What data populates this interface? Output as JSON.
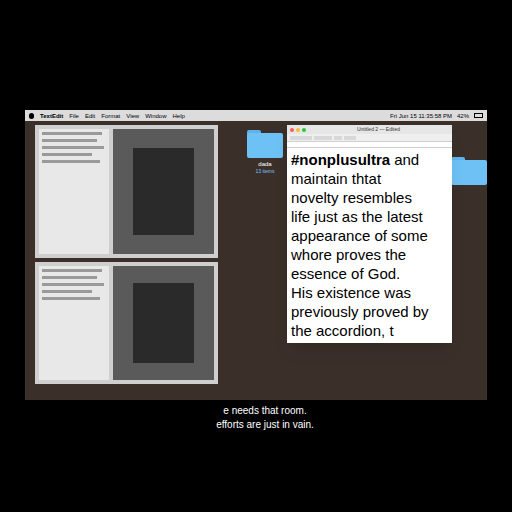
{
  "menubar": {
    "app": "TextEdit",
    "menus": [
      "File",
      "Edit",
      "Format",
      "View",
      "Window",
      "Help"
    ],
    "clock": "Fri Jun 15 11:35:58 PM",
    "battery": "42%"
  },
  "desktop_icons": [
    {
      "label": "dada",
      "sublabel": "13 items"
    }
  ],
  "textedit": {
    "title": "Untitled 2 — Edited",
    "hashtag": "#nonplusultra",
    "first_line_rest": "and",
    "lines": [
      "maintain thtat",
      "novelty resembles",
      "life just as the latest",
      "appearance of some",
      "whore proves the",
      "essence of God.",
      "His existence was",
      "previously proved by",
      "the accordion, t"
    ]
  },
  "subtitles": [
    "e needs that room.",
    "efforts are just in vain."
  ]
}
